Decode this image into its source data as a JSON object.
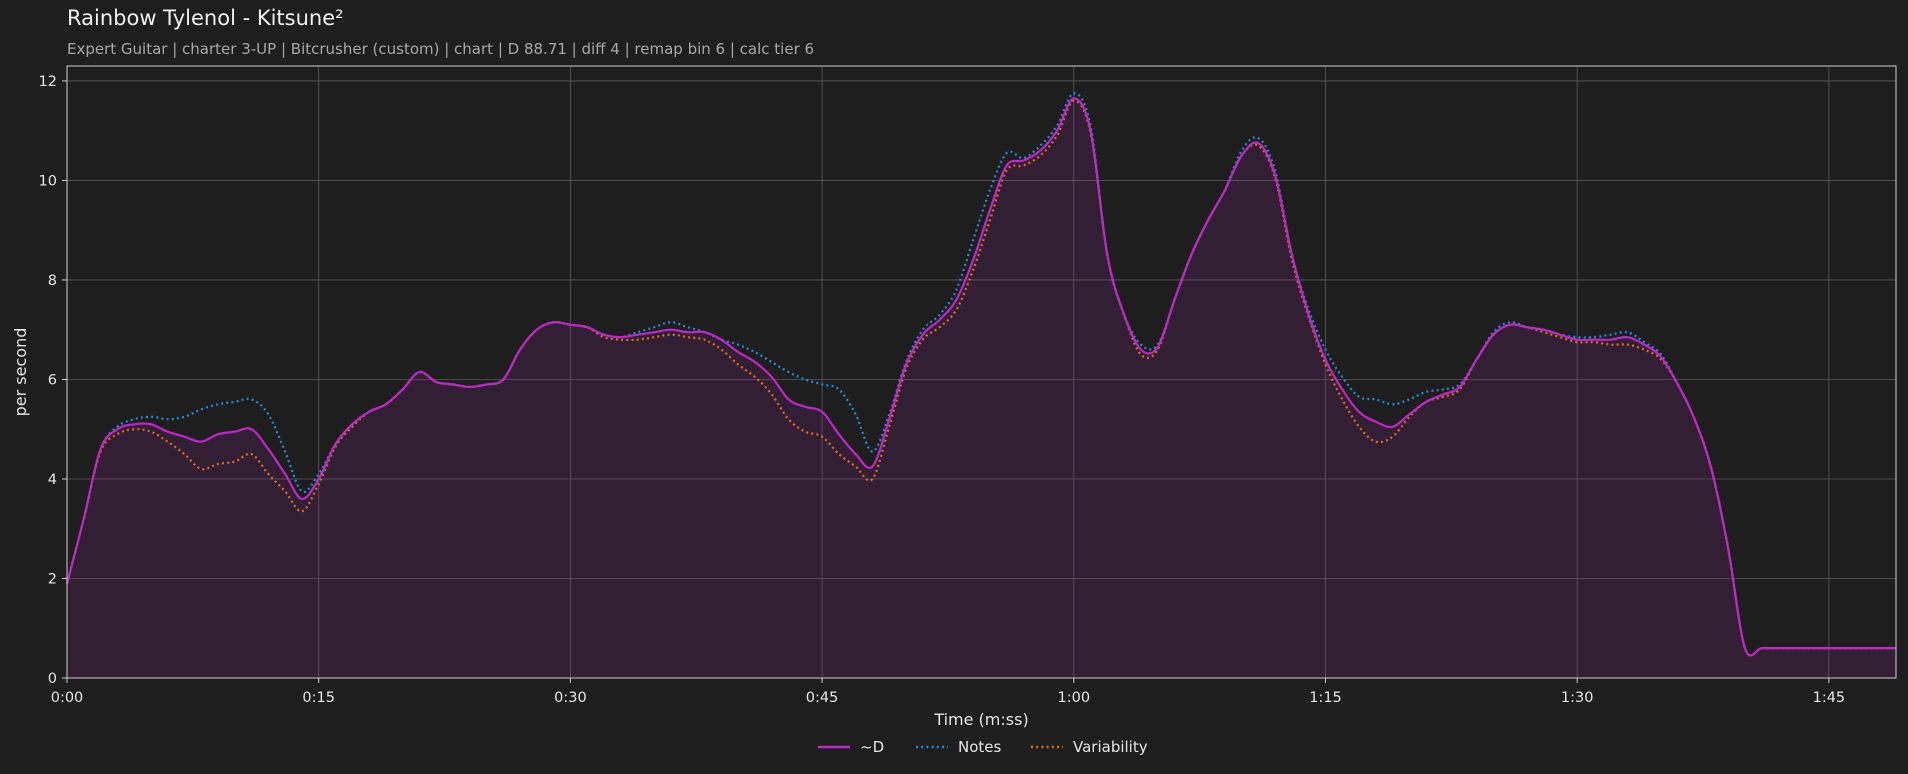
{
  "header": {
    "title": "Rainbow Tylenol - Kitsune²",
    "subtitle": "Expert Guitar  |  charter 3-UP  |  Bitcrusher (custom)  |  chart  |  D 88.71  |  diff 4  |  remap bin 6  |  calc tier 6"
  },
  "chart_data": {
    "type": "line",
    "xlabel": "Time (m:ss)",
    "ylabel": "per second",
    "xlim": [
      0,
      109
    ],
    "ylim": [
      0,
      12.3
    ],
    "xticks": [
      0,
      15,
      30,
      45,
      60,
      75,
      90,
      105
    ],
    "xtick_labels": [
      "0:00",
      "0:15",
      "0:30",
      "0:45",
      "1:00",
      "1:15",
      "1:30",
      "1:45"
    ],
    "yticks": [
      0,
      2,
      4,
      6,
      8,
      10,
      12
    ],
    "ytick_labels": [
      "0",
      "2",
      "4",
      "6",
      "8",
      "10",
      "12"
    ],
    "grid": true,
    "legend": "bottom-center",
    "x": [
      0,
      1,
      2,
      3,
      4,
      5,
      6,
      7,
      8,
      9,
      10,
      11,
      12,
      13,
      14,
      15,
      16,
      17,
      18,
      19,
      20,
      21,
      22,
      23,
      24,
      25,
      26,
      27,
      28,
      29,
      30,
      31,
      32,
      33,
      34,
      35,
      36,
      37,
      38,
      39,
      40,
      41,
      42,
      43,
      44,
      45,
      46,
      47,
      48,
      49,
      50,
      51,
      52,
      53,
      54,
      55,
      56,
      57,
      58,
      59,
      60,
      61,
      62,
      63,
      64,
      65,
      66,
      67,
      68,
      69,
      70,
      71,
      72,
      73,
      74,
      75,
      76,
      77,
      78,
      79,
      80,
      81,
      82,
      83,
      84,
      85,
      86,
      87,
      88,
      89,
      90,
      91,
      92,
      93,
      94,
      95,
      96,
      97,
      98,
      99,
      100,
      101,
      102,
      103,
      104,
      105,
      106,
      107,
      108,
      109
    ],
    "series": [
      {
        "name": "~D",
        "color": "#c026c8",
        "style": "solid",
        "fill": true,
        "values": [
          1.9,
          3.2,
          4.6,
          5.0,
          5.1,
          5.1,
          4.95,
          4.85,
          4.75,
          4.9,
          4.95,
          5.0,
          4.6,
          4.1,
          3.6,
          4.0,
          4.7,
          5.1,
          5.35,
          5.5,
          5.8,
          6.15,
          5.95,
          5.9,
          5.85,
          5.9,
          6.0,
          6.6,
          7.0,
          7.15,
          7.1,
          7.05,
          6.9,
          6.85,
          6.9,
          6.95,
          7.0,
          6.95,
          6.95,
          6.8,
          6.55,
          6.35,
          6.05,
          5.6,
          5.45,
          5.35,
          4.9,
          4.5,
          4.25,
          5.2,
          6.3,
          6.9,
          7.2,
          7.6,
          8.4,
          9.4,
          10.3,
          10.4,
          10.6,
          11.0,
          11.65,
          11.0,
          8.5,
          7.3,
          6.6,
          6.65,
          7.6,
          8.5,
          9.2,
          9.8,
          10.5,
          10.75,
          10.1,
          8.5,
          7.3,
          6.4,
          5.8,
          5.35,
          5.15,
          5.05,
          5.3,
          5.55,
          5.7,
          5.85,
          6.4,
          6.9,
          7.1,
          7.05,
          7.0,
          6.9,
          6.8,
          6.8,
          6.8,
          6.85,
          6.7,
          6.45,
          5.9,
          5.2,
          4.2,
          2.6,
          0.6,
          0.6,
          0.6,
          0.6,
          0.6,
          0.6,
          0.6,
          0.6,
          0.6,
          0.6
        ]
      },
      {
        "name": "Notes",
        "color": "#1f8fd6",
        "style": "dotted",
        "values": [
          1.9,
          3.2,
          4.6,
          5.05,
          5.2,
          5.25,
          5.2,
          5.25,
          5.4,
          5.5,
          5.55,
          5.6,
          5.3,
          4.55,
          3.75,
          4.1,
          4.7,
          5.1,
          5.35,
          5.5,
          5.8,
          6.15,
          5.95,
          5.9,
          5.85,
          5.9,
          6.0,
          6.6,
          7.0,
          7.15,
          7.1,
          7.05,
          6.9,
          6.85,
          6.95,
          7.05,
          7.15,
          7.05,
          6.95,
          6.8,
          6.7,
          6.55,
          6.35,
          6.15,
          6.0,
          5.9,
          5.8,
          5.3,
          4.55,
          5.3,
          6.35,
          7.0,
          7.3,
          7.8,
          8.8,
          9.8,
          10.55,
          10.45,
          10.7,
          11.1,
          11.75,
          11.1,
          8.5,
          7.3,
          6.7,
          6.7,
          7.6,
          8.5,
          9.2,
          9.8,
          10.6,
          10.85,
          10.2,
          8.5,
          7.4,
          6.6,
          6.05,
          5.65,
          5.6,
          5.5,
          5.6,
          5.75,
          5.8,
          5.9,
          6.4,
          6.95,
          7.15,
          7.05,
          7.0,
          6.9,
          6.85,
          6.85,
          6.9,
          6.95,
          6.75,
          6.5,
          5.9,
          5.2,
          4.2,
          2.6,
          0.6,
          0.6,
          0.6,
          0.6,
          0.6,
          0.6,
          0.6,
          0.6,
          0.6,
          0.6
        ]
      },
      {
        "name": "Variability",
        "color": "#e0701c",
        "style": "dotted",
        "values": [
          1.9,
          3.2,
          4.55,
          4.9,
          5.0,
          4.95,
          4.75,
          4.5,
          4.2,
          4.3,
          4.35,
          4.5,
          4.1,
          3.75,
          3.35,
          3.9,
          4.65,
          5.05,
          5.35,
          5.5,
          5.8,
          6.15,
          5.95,
          5.9,
          5.85,
          5.9,
          6.0,
          6.6,
          7.0,
          7.15,
          7.1,
          7.05,
          6.85,
          6.8,
          6.8,
          6.85,
          6.9,
          6.85,
          6.8,
          6.6,
          6.3,
          6.05,
          5.7,
          5.2,
          4.95,
          4.85,
          4.5,
          4.25,
          4.0,
          5.05,
          6.2,
          6.8,
          7.05,
          7.4,
          8.2,
          9.2,
          10.2,
          10.3,
          10.5,
          10.9,
          11.6,
          10.95,
          8.5,
          7.3,
          6.5,
          6.6,
          7.6,
          8.5,
          9.2,
          9.8,
          10.5,
          10.7,
          10.05,
          8.4,
          7.25,
          6.3,
          5.6,
          5.05,
          4.75,
          4.85,
          5.25,
          5.55,
          5.65,
          5.8,
          6.4,
          6.9,
          7.1,
          7.05,
          6.95,
          6.85,
          6.75,
          6.75,
          6.7,
          6.7,
          6.6,
          6.4,
          5.9,
          5.2,
          4.2,
          2.6,
          0.6,
          0.6,
          0.6,
          0.6,
          0.6,
          0.6,
          0.6,
          0.6,
          0.6,
          0.6
        ]
      }
    ]
  }
}
